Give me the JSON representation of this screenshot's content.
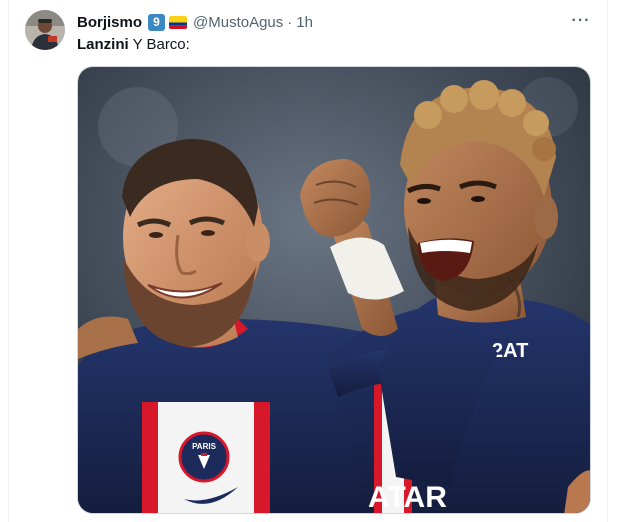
{
  "tweet": {
    "display_name": "Borjismo",
    "badge_number": "9",
    "handle": "@MustoAgus",
    "separator": "·",
    "time": "1h",
    "more_label": "···",
    "text_bold": "Lanzini",
    "text_rest": " Y Barco:"
  },
  "media": {
    "shirt_badge_text": "PARIS",
    "shirt_sponsor_text": "ATAR",
    "sleeve_number": "2AT"
  },
  "colors": {
    "text_primary": "#0f1419",
    "text_secondary": "#536471",
    "jersey_navy": "#1c2a5c",
    "jersey_red": "#d7182a"
  },
  "icons": {
    "more": "more-horizontal-icon",
    "flag": "colombia-flag-icon",
    "badge": "keycap-nine-icon"
  }
}
